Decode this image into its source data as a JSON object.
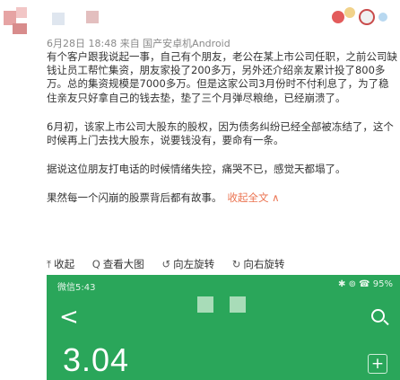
{
  "post": {
    "meta": "6月28日 18:48 来自 国产安卓机Android",
    "paragraphs": [
      "有个客户跟我说起一事，自己有个朋友，老公在某上市公司任职，之前公司缺钱让员工帮忙集资，朋友家投了200多万，另外还介绍亲友累计投了800多万。总的集资规模是7000多万。但是这家公司3月份时不付利息了，为了稳住亲友只好拿自己的钱去垫，垫了三个月弹尽粮绝，已经崩溃了。",
      "6月初，该家上市公司大股东的股权，因为债务纠纷已经全部被冻结了，这个时候再上门去找大股东，说要钱没有，要命有一条。",
      "据说这位朋友打电话的时候情绪失控，痛哭不已，感觉天都塌了。"
    ],
    "last_line": "果然每一个闪崩的股票背后都有故事。",
    "collapse_label": "收起全文 ∧"
  },
  "actions": [
    {
      "icon": "collapse-icon",
      "glyph": "⤒",
      "label": "收起"
    },
    {
      "icon": "magnify-icon",
      "glyph": "Q",
      "label": "查看大图"
    },
    {
      "icon": "rotate-left-icon",
      "glyph": "↺",
      "label": "向左旋转"
    },
    {
      "icon": "rotate-right-icon",
      "glyph": "↻",
      "label": "向右旋转"
    }
  ],
  "screenshot": {
    "status_time": "微信5:43",
    "status_right": "✱ ⊚ ☎ 95%",
    "back_glyph": "<",
    "price": "3.04",
    "plus_glyph": "+"
  }
}
